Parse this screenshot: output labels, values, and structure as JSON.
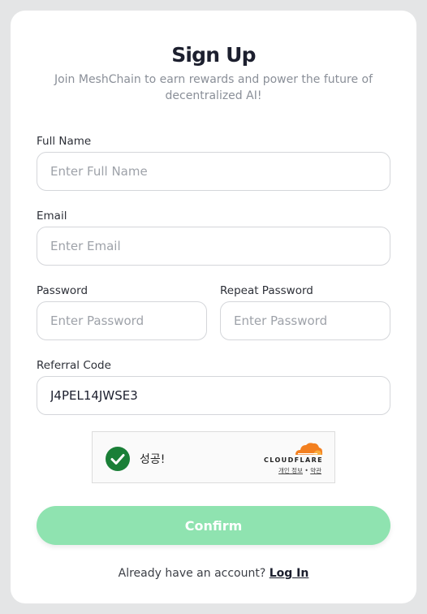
{
  "header": {
    "title": "Sign Up",
    "subtitle": "Join MeshChain to earn rewards and power the future of decentralized AI!"
  },
  "form": {
    "full_name": {
      "label": "Full Name",
      "placeholder": "Enter Full Name",
      "value": ""
    },
    "email": {
      "label": "Email",
      "placeholder": "Enter Email",
      "value": ""
    },
    "password": {
      "label": "Password",
      "placeholder": "Enter Password",
      "value": ""
    },
    "repeat_password": {
      "label": "Repeat Password",
      "placeholder": "Enter Password",
      "value": ""
    },
    "referral_code": {
      "label": "Referral Code",
      "placeholder": "",
      "value": "J4PEL14JWSE3"
    }
  },
  "captcha": {
    "status_text": "성공!",
    "status_icon": "checkmark-icon",
    "brand": "CLOUDFLARE",
    "privacy_link": "개인 정보",
    "separator": "•",
    "terms_link": "약관",
    "brand_color": "#f38020",
    "success_color": "#1a7f37"
  },
  "actions": {
    "confirm_label": "Confirm",
    "confirm_color": "#8fe3b0"
  },
  "footer": {
    "prompt": "Already have an account?",
    "login_label": "Log In"
  }
}
